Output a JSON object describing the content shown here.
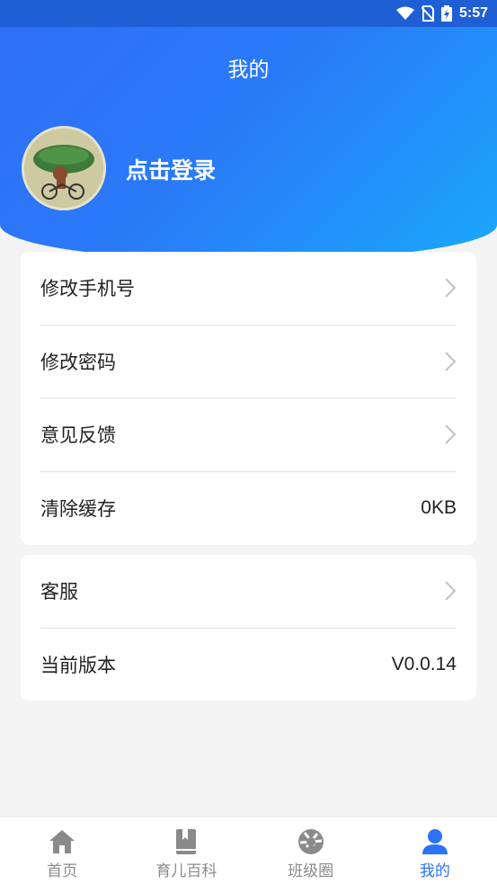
{
  "status_bar": {
    "time": "5:57",
    "icons": [
      "wifi-icon",
      "no-sim-icon",
      "battery-icon"
    ]
  },
  "header": {
    "title": "我的",
    "login_text": "点击登录"
  },
  "menu_group_1": [
    {
      "label": "修改手机号",
      "value": null,
      "chevron": true
    },
    {
      "label": "修改密码",
      "value": null,
      "chevron": true
    },
    {
      "label": "意见反馈",
      "value": null,
      "chevron": true
    },
    {
      "label": "清除缓存",
      "value": "0KB",
      "chevron": false
    }
  ],
  "menu_group_2": [
    {
      "label": "客服",
      "value": null,
      "chevron": true
    },
    {
      "label": "当前版本",
      "value": "V0.0.14",
      "chevron": false
    }
  ],
  "tabs": [
    {
      "label": "首页",
      "icon": "home-icon",
      "active": false
    },
    {
      "label": "育儿百科",
      "icon": "book-icon",
      "active": false
    },
    {
      "label": "班级圈",
      "icon": "aperture-icon",
      "active": false
    },
    {
      "label": "我的",
      "icon": "user-icon",
      "active": true
    }
  ],
  "colors": {
    "accent": "#2a73f5",
    "header_start": "#2f6ff6",
    "header_end": "#1aa8fb",
    "inactive": "#8a8a8a"
  }
}
